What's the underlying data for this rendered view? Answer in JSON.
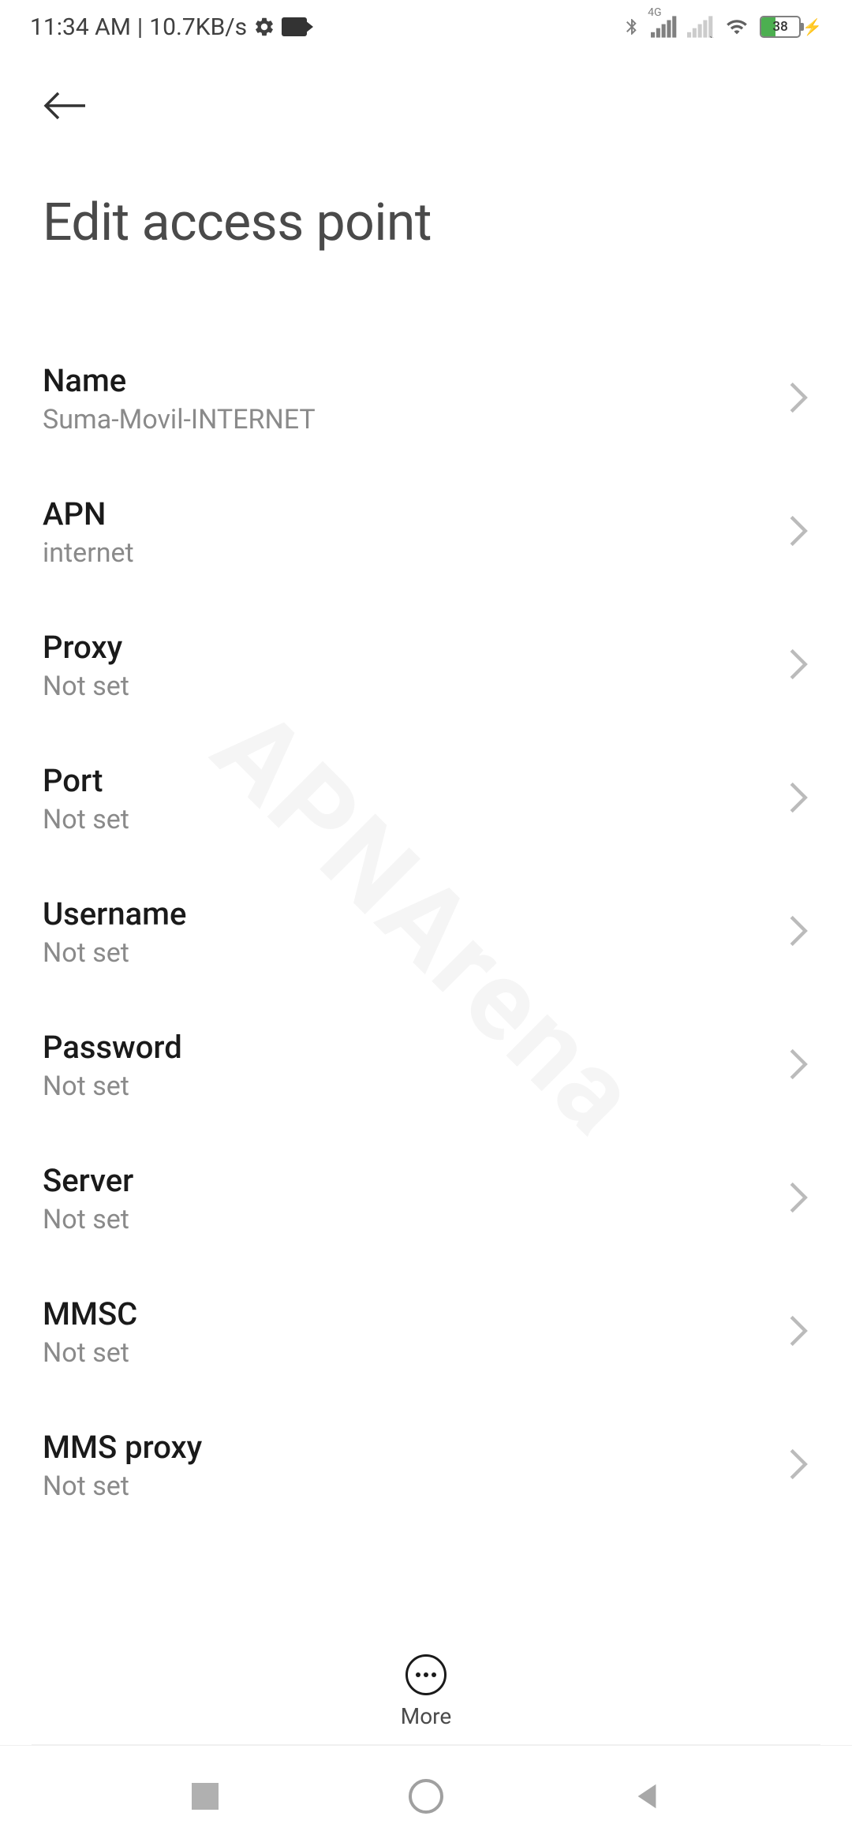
{
  "status_bar": {
    "time": "11:34 AM",
    "data_speed": "10.7KB/s",
    "battery_percent": "38"
  },
  "header": {
    "title": "Edit access point"
  },
  "settings": [
    {
      "label": "Name",
      "value": "Suma-Movil-INTERNET"
    },
    {
      "label": "APN",
      "value": "internet"
    },
    {
      "label": "Proxy",
      "value": "Not set"
    },
    {
      "label": "Port",
      "value": "Not set"
    },
    {
      "label": "Username",
      "value": "Not set"
    },
    {
      "label": "Password",
      "value": "Not set"
    },
    {
      "label": "Server",
      "value": "Not set"
    },
    {
      "label": "MMSC",
      "value": "Not set"
    },
    {
      "label": "MMS proxy",
      "value": "Not set"
    }
  ],
  "toolbar": {
    "more_label": "More"
  },
  "watermark": "APNArena"
}
